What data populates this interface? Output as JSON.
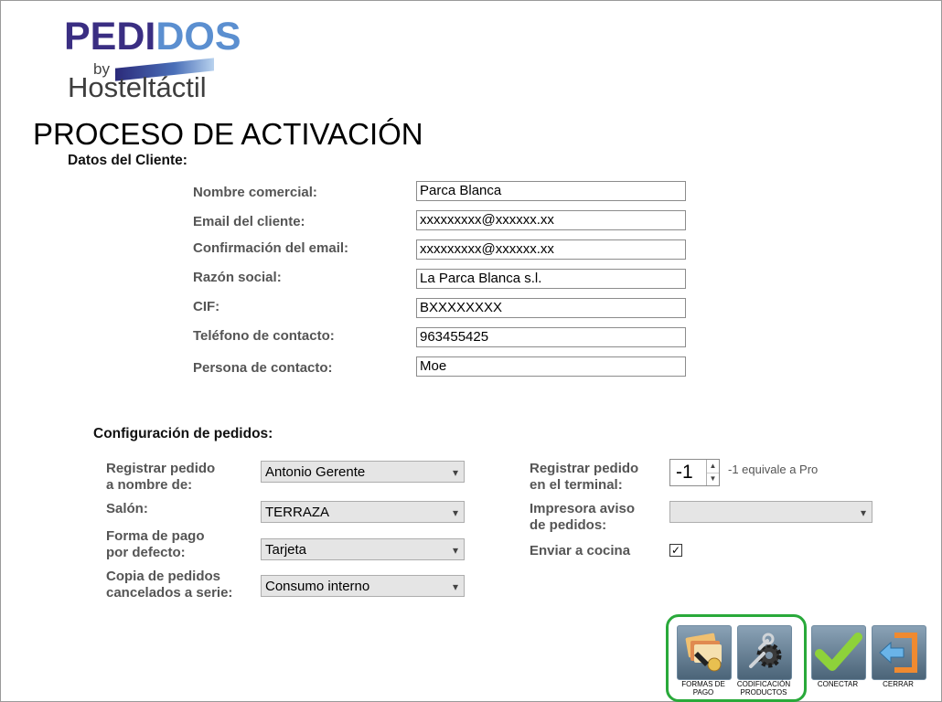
{
  "logo": {
    "line1a": "PEDI",
    "line1b": "DOS",
    "line2": "by",
    "line3": "Hosteltáctil"
  },
  "title": "PROCESO DE ACTIVACIÓN",
  "cliente": {
    "heading": "Datos del Cliente:",
    "fields": [
      {
        "label": "Nombre comercial:",
        "value": "Parca Blanca"
      },
      {
        "label": "Email del cliente:",
        "value": "xxxxxxxxx@xxxxxx.xx"
      },
      {
        "label": "Confirmación del email:",
        "value": "xxxxxxxxx@xxxxxx.xx"
      },
      {
        "label": "Razón social:",
        "value": "La Parca Blanca s.l."
      },
      {
        "label": "CIF:",
        "value": "BXXXXXXXX"
      },
      {
        "label": "Teléfono de contacto:",
        "value": "963455425"
      },
      {
        "label": "Persona de contacto:",
        "value": "Moe"
      }
    ]
  },
  "config": {
    "heading": "Configuración de pedidos:",
    "registrar_nombre": {
      "label1": "Registrar pedido",
      "label2": "a nombre de:",
      "value": "Antonio Gerente"
    },
    "salon": {
      "label": "Salón:",
      "value": "TERRAZA"
    },
    "forma_pago": {
      "label1": "Forma de pago",
      "label2": "por defecto:",
      "value": "Tarjeta"
    },
    "copia": {
      "label1": "Copia de pedidos",
      "label2": "cancelados a serie:",
      "value": "Consumo interno"
    },
    "terminal": {
      "label1": "Registrar pedido",
      "label2": "en el terminal:",
      "value": "-1",
      "hint": "-1 equivale a Pro"
    },
    "impresora": {
      "label1": "Impresora aviso",
      "label2": "de pedidos:",
      "value": ""
    },
    "cocina": {
      "label": "Enviar a cocina",
      "checked": true,
      "mark": "✓"
    }
  },
  "buttons": {
    "formas_pago": {
      "line1": "FORMAS DE",
      "line2": "PAGO"
    },
    "codificacion": {
      "line1": "CODIFICACIÓN",
      "line2": "PRODUCTOS"
    },
    "conectar": "CONECTAR",
    "cerrar": "CERRAR"
  },
  "icons": {
    "dropdown": "▾",
    "spin_up": "▲",
    "spin_down": "▼"
  },
  "colors": {
    "highlight": "#29a93a",
    "brand_dark": "#3a2e82",
    "brand_light": "#5b8fd0"
  }
}
